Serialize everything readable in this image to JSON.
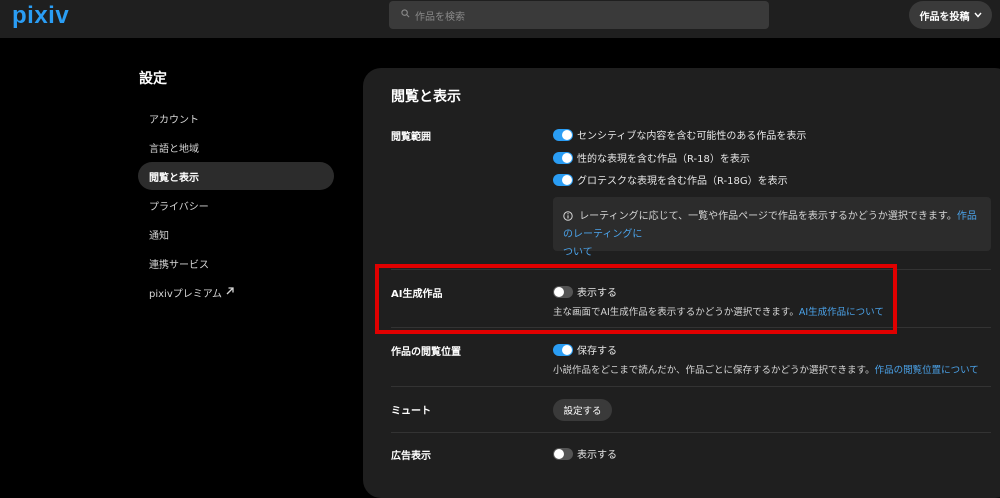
{
  "header": {
    "logo": "pixiv",
    "search_placeholder": "作品を検索",
    "post_button": "作品を投稿"
  },
  "sidebar": {
    "title": "設定",
    "items": [
      {
        "label": "アカウント"
      },
      {
        "label": "言語と地域"
      },
      {
        "label": "閲覧と表示"
      },
      {
        "label": "プライバシー"
      },
      {
        "label": "通知"
      },
      {
        "label": "連携サービス"
      },
      {
        "label": "pixivプレミアム"
      }
    ]
  },
  "main": {
    "title": "閲覧と表示",
    "viewing_range": {
      "label": "閲覧範囲",
      "options": [
        {
          "label": "センシティブな内容を含む可能性のある作品を表示",
          "on": true
        },
        {
          "label": "性的な表現を含む作品（R-18）を表示",
          "on": true
        },
        {
          "label": "グロテスクな表現を含む作品（R-18G）を表示",
          "on": true
        }
      ],
      "info_text": "レーティングに応じて、一覧や作品ページで作品を表示するかどうか選択できます。",
      "info_link_1": "作品のレーティングに",
      "info_link_2": "ついて"
    },
    "ai": {
      "label": "AI生成作品",
      "toggle_label": "表示する",
      "on": false,
      "desc": "主な画面でAI生成作品を表示するかどうか選択できます。",
      "link": "AI生成作品について"
    },
    "position": {
      "label": "作品の閲覧位置",
      "toggle_label": "保存する",
      "on": true,
      "desc": "小説作品をどこまで読んだか、作品ごとに保存するかどうか選択できます。",
      "link": "作品の閲覧位置について"
    },
    "mute": {
      "label": "ミュート",
      "button": "設定する"
    },
    "ads": {
      "label": "広告表示",
      "toggle_label": "表示する",
      "on": false
    }
  },
  "colors": {
    "accent": "#2a9df4",
    "link": "#4ba3ea",
    "highlight": "#e00000"
  }
}
